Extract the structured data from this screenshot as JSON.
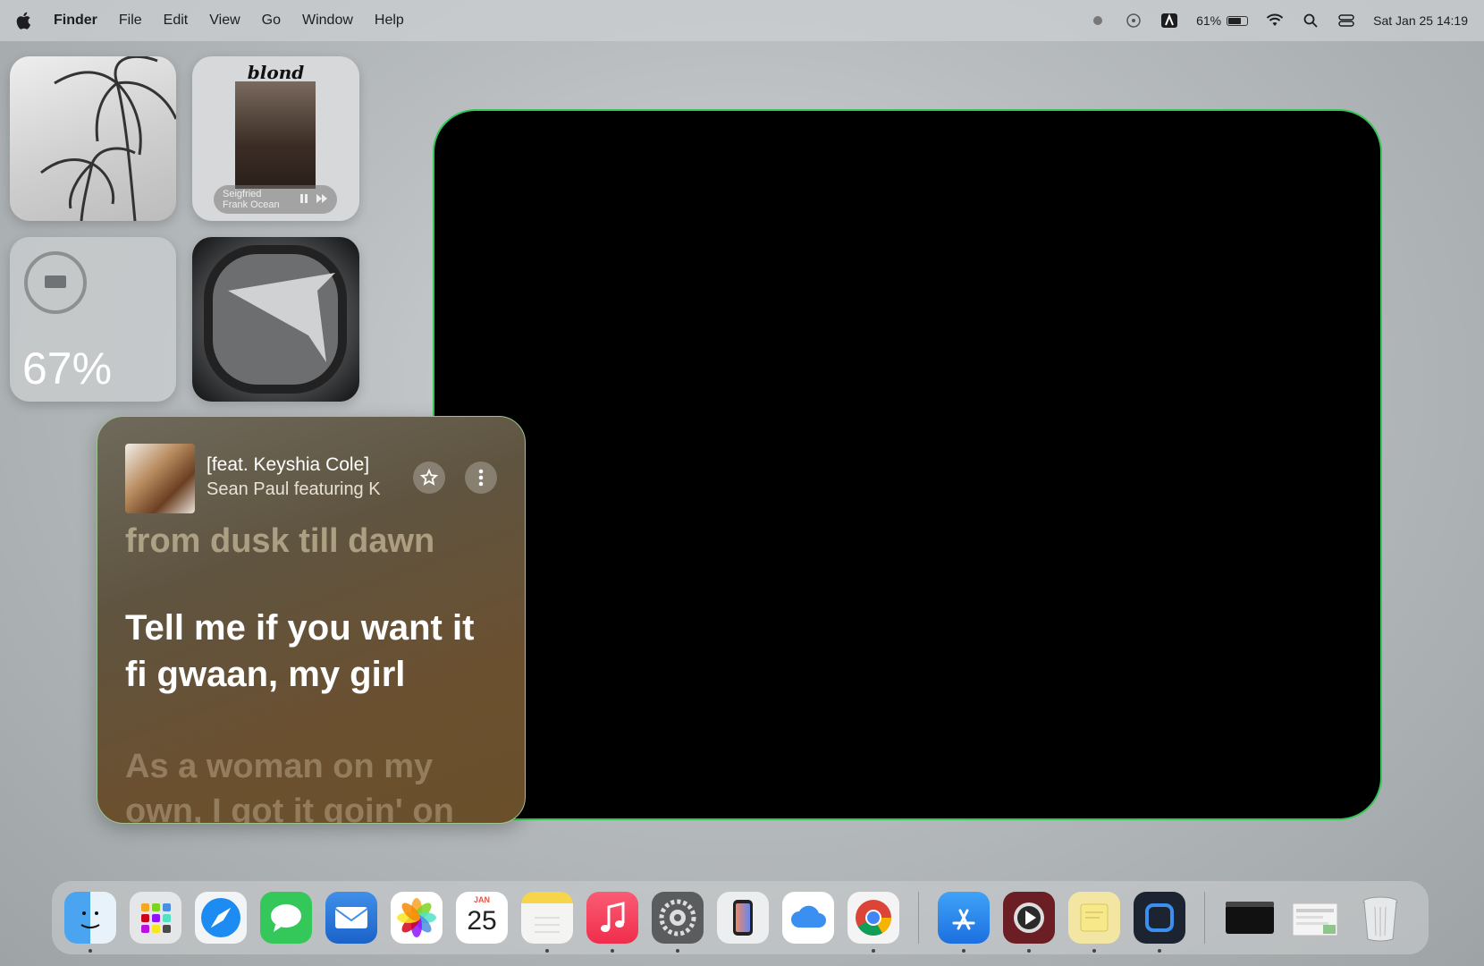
{
  "menubar": {
    "apple_icon": "apple-icon",
    "items": [
      "Finder",
      "File",
      "Edit",
      "View",
      "Go",
      "Window",
      "Help"
    ],
    "battery_percent": "61%",
    "battery_level": 0.61,
    "datetime": "Sat Jan 25  14:19"
  },
  "widgets": {
    "album_title": "blond",
    "now_playing_track": "Seigfried",
    "now_playing_artist": "Frank Ocean",
    "battery_percent": "67%"
  },
  "lyrics": {
    "song_title": "[feat. Keyshia Cole]",
    "artist": "Sean Paul featuring K",
    "line_prev": "from dusk till dawn",
    "line_current": "Tell me if you want it\nfi gwaan, my girl",
    "line_next": "As a woman on my\nown, I got it goin' on"
  },
  "dock": {
    "apps": [
      "finder",
      "launchpad",
      "safari",
      "messages",
      "mail",
      "photos",
      "calendar",
      "notes",
      "music",
      "system-settings",
      "iphone-mirroring",
      "icloud-drive",
      "chrome",
      "app-store",
      "quicktime",
      "stickies",
      "screen-recorder",
      "terminal-folder",
      "preview-document",
      "trash"
    ],
    "calendar_month": "JAN",
    "calendar_day": "25"
  },
  "colors": {
    "panel_border": "#34c759",
    "lyrics_bg": "#6b5030"
  }
}
